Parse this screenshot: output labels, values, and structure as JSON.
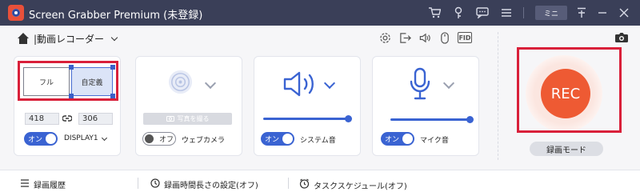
{
  "titlebar": {
    "title": "Screen Grabber Premium (未登録)",
    "mini_label": "ミニ",
    "icons": [
      "cart-icon",
      "key-icon",
      "chat-icon",
      "menu-icon",
      "pin-icon",
      "minimize-icon",
      "close-icon"
    ]
  },
  "mode": {
    "label": "|動画レコーダー"
  },
  "toolbar_icons": [
    "gear-icon",
    "export-icon",
    "speaker-icon",
    "mouse-icon",
    "fid-icon"
  ],
  "toolbar": {
    "fid_label": "FID"
  },
  "region": {
    "full_label": "フル",
    "custom_label": "自定義",
    "width": "418",
    "height": "306",
    "toggle_label": "オン",
    "display_label": "DISPLAY1"
  },
  "webcam": {
    "photo_button": "写真を撮る",
    "toggle_label": "オフ",
    "label": "ウェブカメラ"
  },
  "system_audio": {
    "toggle_label": "オン",
    "label": "システム音",
    "volume_percent": 100
  },
  "microphone": {
    "toggle_label": "オン",
    "label": "マイク音",
    "volume_percent": 100
  },
  "record": {
    "rec_label": "REC",
    "mode_label": "録画モード"
  },
  "bottombar": {
    "history": "録画履歴",
    "duration": "録画時間長さの設定(オフ)",
    "schedule": "タスクスケジュール(オフ)"
  },
  "colors": {
    "titlebar": "#3a3f58",
    "accent": "#3a63d2",
    "rec": "#ee5a33",
    "highlight": "#d9203a"
  }
}
